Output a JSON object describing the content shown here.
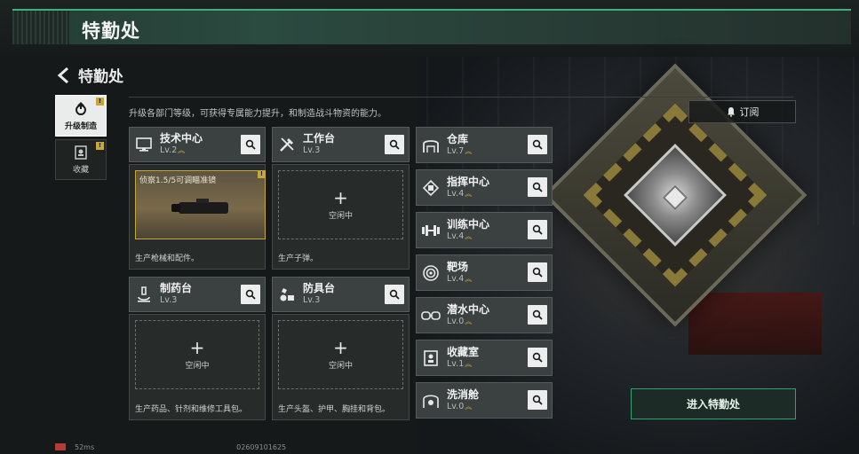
{
  "topbar": {
    "title": "特勤处"
  },
  "header": {
    "title": "特勤处",
    "description": "升级各部门等级，可获得专属能力提升，和制造战斗物资的能力。"
  },
  "subscribe": {
    "label": "订阅"
  },
  "tabs": [
    {
      "label": "升级制造",
      "badge": "!"
    },
    {
      "label": "收藏",
      "badge": "!"
    }
  ],
  "cards": {
    "tech": {
      "name": "技术中心",
      "level": "Lv.2",
      "slot_badge": "!",
      "item_name": "侦察1.5/5可调瞄准镜",
      "footer": "生产枪械和配件。"
    },
    "workbench": {
      "name": "工作台",
      "level": "Lv.3",
      "idle": "空闲中",
      "footer": "生产子弹。"
    },
    "pharmacy": {
      "name": "制药台",
      "level": "Lv.3",
      "idle": "空闲中",
      "footer": "生产药品、针剂和维修工具包。"
    },
    "armor": {
      "name": "防具台",
      "level": "Lv.3",
      "idle": "空闲中",
      "footer": "生产头盔、护甲、胸挂和背包。"
    }
  },
  "side": [
    {
      "name": "仓库",
      "level": "Lv.7",
      "icon": "warehouse-icon"
    },
    {
      "name": "指挥中心",
      "level": "Lv.4",
      "icon": "command-chip-icon"
    },
    {
      "name": "训练中心",
      "level": "Lv.4",
      "icon": "dumbbell-icon"
    },
    {
      "name": "靶场",
      "level": "Lv.4",
      "icon": "target-icon"
    },
    {
      "name": "潜水中心",
      "level": "Lv.0",
      "icon": "diving-mask-icon"
    },
    {
      "name": "收藏室",
      "level": "Lv.1",
      "icon": "collection-icon"
    },
    {
      "name": "洗消舱",
      "level": "Lv.0",
      "icon": "decon-icon"
    }
  ],
  "enter": {
    "label": "进入特勤处"
  },
  "status": {
    "ping": "52ms",
    "uid": "02609101625"
  }
}
